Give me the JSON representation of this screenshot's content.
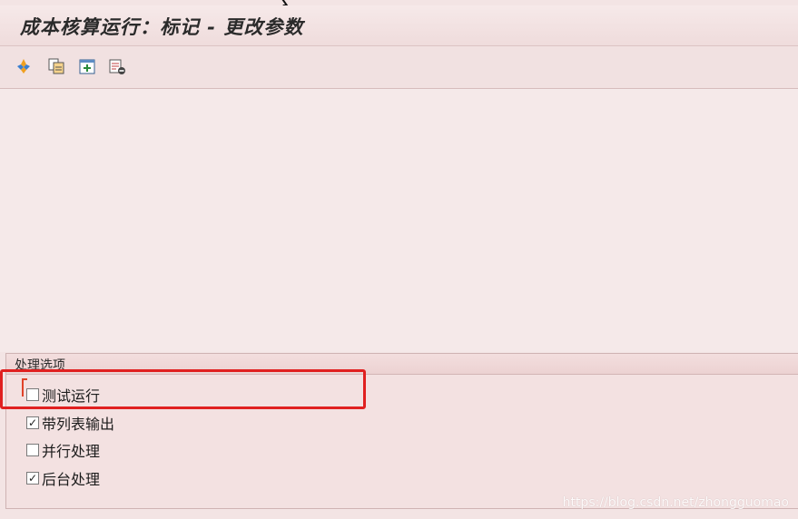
{
  "window": {
    "title": "成本核算运行：标记 - 更改参数"
  },
  "toolbar": {
    "buttons": [
      {
        "icon": "execute-icon"
      },
      {
        "icon": "copy-variant-icon"
      },
      {
        "icon": "get-variant-icon"
      },
      {
        "icon": "delete-icon"
      }
    ]
  },
  "processing_options": {
    "title": "处理选项",
    "options": [
      {
        "label": "测试运行",
        "checked": false
      },
      {
        "label": "带列表输出",
        "checked": true
      },
      {
        "label": "并行处理",
        "checked": false
      },
      {
        "label": "后台处理",
        "checked": true
      }
    ]
  },
  "watermark": "https://blog.csdn.net/zhongguomao",
  "colors": {
    "highlight": "#e02020",
    "background": "#f3e4e4"
  }
}
